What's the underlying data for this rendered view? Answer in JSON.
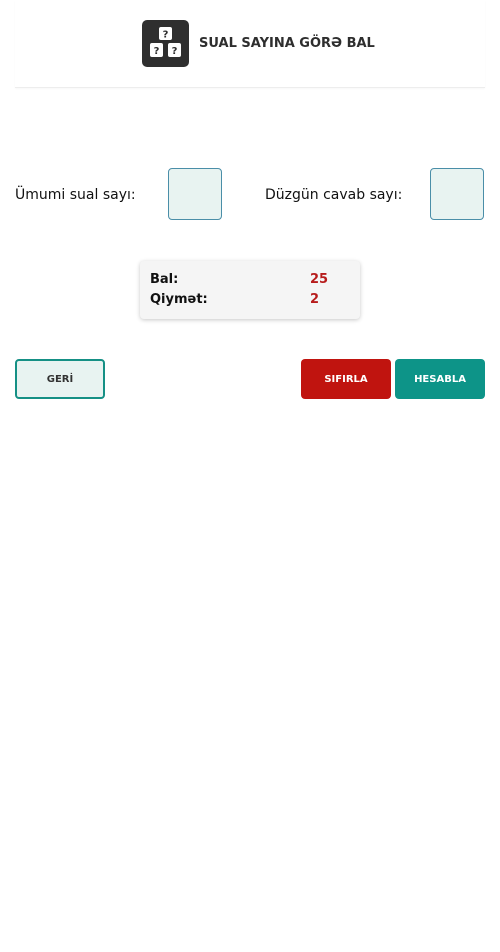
{
  "header": {
    "title": "SUAL SAYINA GÖRƏ BAL",
    "logo_icon": "question-blocks-icon"
  },
  "form": {
    "total_questions_label": "Ümumi sual sayı:",
    "total_questions_value": "",
    "correct_answers_label": "Düzgün cavab sayı:",
    "correct_answers_value": ""
  },
  "result": {
    "score_label": "Bal:",
    "score_value": "25",
    "grade_label": "Qiymət:",
    "grade_value": "2"
  },
  "buttons": {
    "back_label": "GERİ",
    "reset_label": "SIFIRLA",
    "calculate_label": "HESABLA"
  },
  "colors": {
    "accent_teal": "#0d9488",
    "reset_red": "#c0140f",
    "result_red": "#b71c1c",
    "input_bg": "#e8f3f1"
  }
}
